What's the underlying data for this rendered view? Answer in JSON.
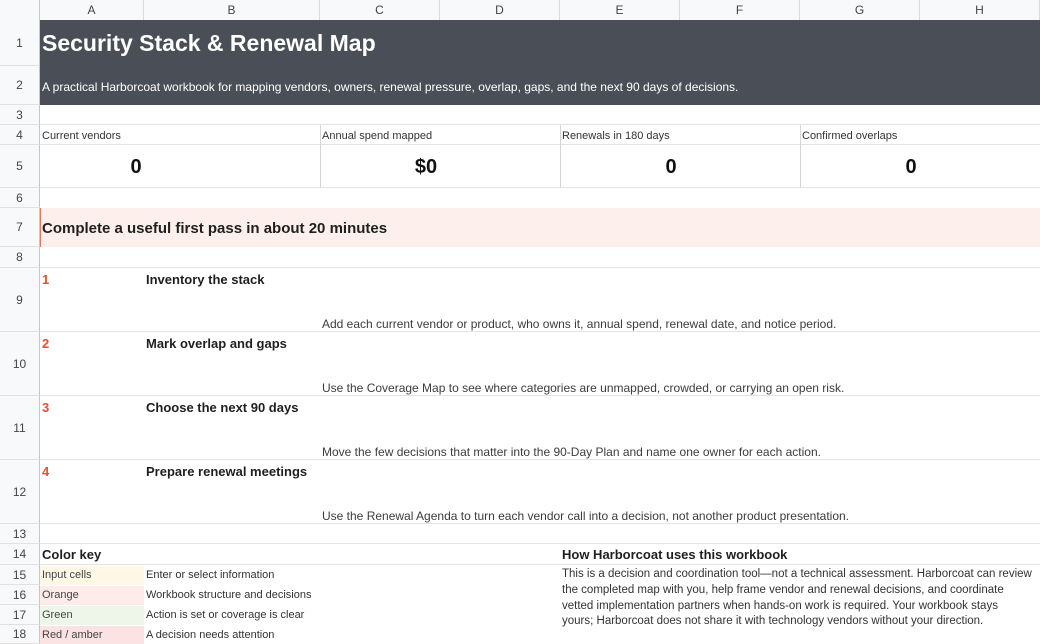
{
  "columns": [
    "A",
    "B",
    "C",
    "D",
    "E",
    "F",
    "G",
    "H"
  ],
  "rows": [
    "1",
    "2",
    "3",
    "4",
    "5",
    "6",
    "7",
    "8",
    "9",
    "10",
    "11",
    "12",
    "13",
    "14",
    "15",
    "16",
    "17",
    "18"
  ],
  "header": {
    "title": "Security Stack & Renewal Map",
    "subtitle": "A practical Harborcoat workbook for mapping vendors, owners, renewal pressure, overlap, gaps, and the next 90 days of decisions."
  },
  "kpis": [
    {
      "label": "Current vendors",
      "value": "0"
    },
    {
      "label": "Annual spend mapped",
      "value": "$0"
    },
    {
      "label": "Renewals in 180 days",
      "value": "0"
    },
    {
      "label": "Confirmed overlaps",
      "value": "0"
    }
  ],
  "section": {
    "title": "Complete a useful first pass in about 20 minutes"
  },
  "steps": [
    {
      "num": "1",
      "title": "Inventory the stack",
      "desc": "Add each current vendor or product, who owns it, annual spend, renewal date, and notice period."
    },
    {
      "num": "2",
      "title": "Mark overlap and gaps",
      "desc": "Use the Coverage Map to see where categories are unmapped, crowded, or carrying an open risk."
    },
    {
      "num": "3",
      "title": "Choose the next 90 days",
      "desc": "Move the few decisions that matter into the 90-Day Plan and name one owner for each action."
    },
    {
      "num": "4",
      "title": "Prepare renewal meetings",
      "desc": "Use the Renewal Agenda to turn each vendor call into a decision, not another product presentation."
    }
  ],
  "color_key": {
    "title": "Color key",
    "items": [
      {
        "label": "Input cells",
        "desc": "Enter or select information",
        "color": "#fff8e6"
      },
      {
        "label": "Orange",
        "desc": "Workbook structure and decisions",
        "color": "#fdecea"
      },
      {
        "label": "Green",
        "desc": "Action is set or coverage is clear",
        "color": "#eef5e9"
      },
      {
        "label": "Red / amber",
        "desc": "A decision needs attention",
        "color": "#fbe3e3"
      }
    ]
  },
  "about": {
    "title": "How Harborcoat uses this workbook",
    "text": "This is a decision and coordination tool—not a technical assessment. Harborcoat can review the completed map with you, help frame vendor and renewal decisions, and coordinate vetted implementation partners when hands-on work is required. Your workbook stays yours; Harborcoat does not share it with technology vendors without your direction."
  },
  "colors": {
    "title_band": "#4a4f57",
    "accent": "#e2512d",
    "section_band": "#fdf0ec"
  }
}
